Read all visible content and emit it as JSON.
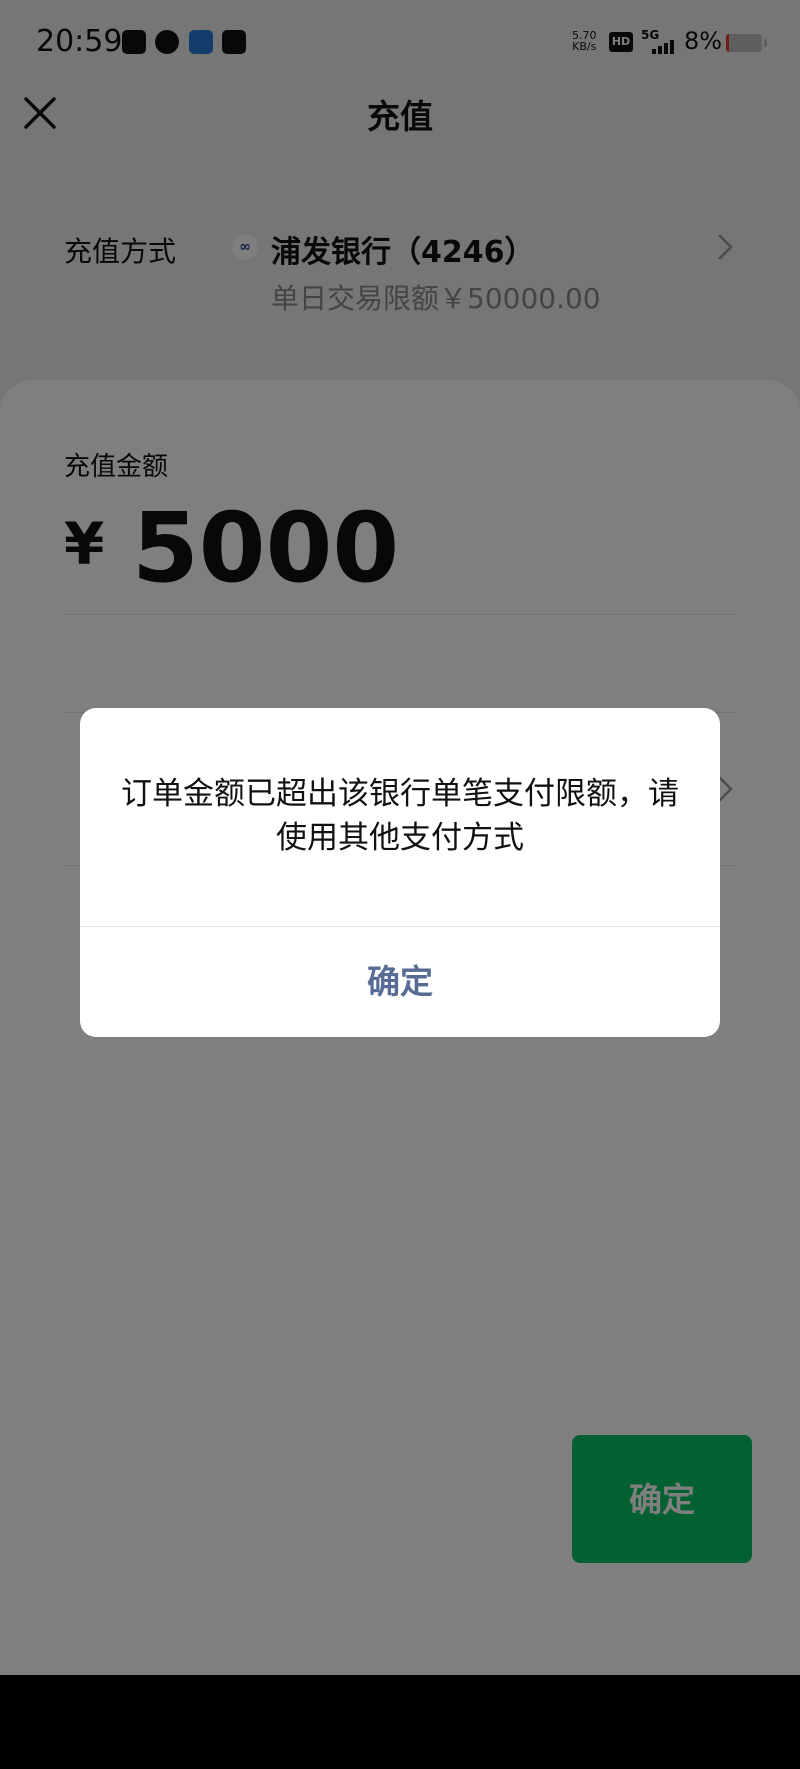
{
  "status_bar": {
    "time": "20:59",
    "speed_value": "5.70",
    "speed_unit": "KB/s",
    "hd": "HD",
    "network": "5G",
    "battery": "8%",
    "battery_level": 0.08
  },
  "header": {
    "title": "充值",
    "close_icon": "close-icon"
  },
  "method": {
    "label": "充值方式",
    "bank_name": "浦发银行（4246）",
    "limit": "单日交易限额￥50000.00",
    "logo_icon": "bank-logo-icon"
  },
  "amount": {
    "label": "充值金额",
    "currency": "¥",
    "value": "5000"
  },
  "confirm_button": "确定",
  "dialog": {
    "message": "订单金额已超出该银行单笔支付限额，请使用其他支付方式",
    "button": "确定"
  },
  "colors": {
    "accent_green": "#07c160",
    "dialog_link": "#576b95",
    "battery_low": "#e53935"
  }
}
